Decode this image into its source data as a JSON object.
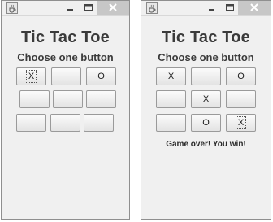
{
  "windows": [
    {
      "title_bar": {
        "icon": "java-cup-icon",
        "minimize_icon": "minimize-icon",
        "maximize_icon": "maximize-icon",
        "close_icon": "close-icon"
      },
      "title": "Tic Tac Toe",
      "subtitle": "Choose one button",
      "board": [
        "X",
        "",
        "O",
        "",
        "",
        "",
        "",
        "",
        ""
      ],
      "focused_cell": 0,
      "status": ""
    },
    {
      "title_bar": {
        "icon": "java-cup-icon",
        "minimize_icon": "minimize-icon",
        "maximize_icon": "maximize-icon",
        "close_icon": "close-icon"
      },
      "title": "Tic Tac Toe",
      "subtitle": "Choose one button",
      "board": [
        "X",
        "",
        "O",
        "",
        "X",
        "",
        "",
        "O",
        "X"
      ],
      "focused_cell": 8,
      "status": "Game over! You win!"
    }
  ]
}
